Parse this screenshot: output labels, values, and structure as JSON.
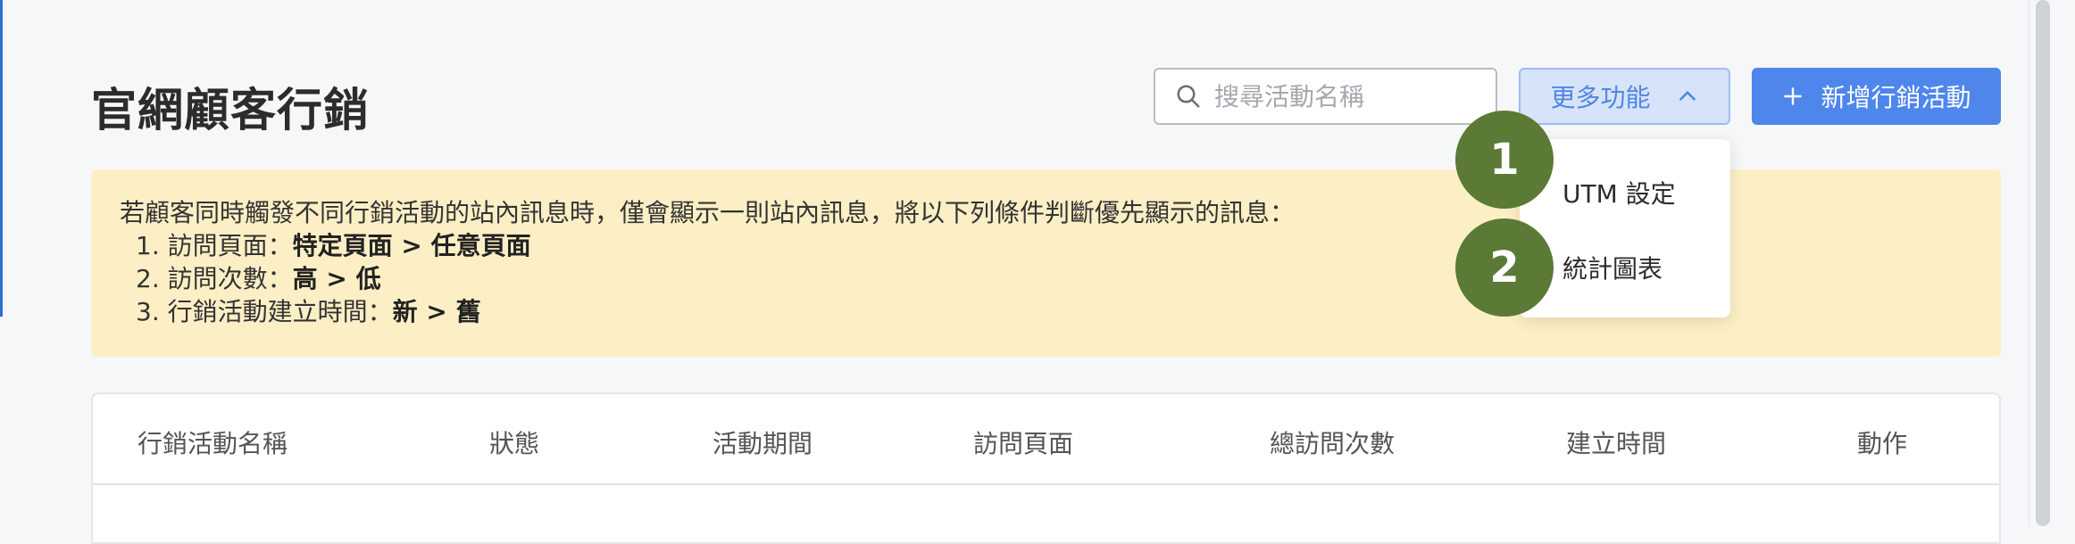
{
  "page_title": "官網顧客行銷",
  "search": {
    "placeholder": "搜尋活動名稱"
  },
  "toolbar": {
    "more_label": "更多功能",
    "add_label": "新增行銷活動"
  },
  "dropdown": {
    "items": [
      {
        "label": "UTM 設定",
        "badge": "1"
      },
      {
        "label": "統計圖表",
        "badge": "2"
      }
    ]
  },
  "notice": {
    "intro": "若顧客同時觸發不同行銷活動的站內訊息時，僅會顯示一則站內訊息，將以下列條件判斷優先顯示的訊息：",
    "items": [
      {
        "prefix": "1. 訪問頁面：",
        "rule": "特定頁面 > 任意頁面"
      },
      {
        "prefix": "2. 訪問次數：",
        "rule": "高 > 低"
      },
      {
        "prefix": "3. 行銷活動建立時間：",
        "rule": "新 > 舊"
      }
    ]
  },
  "table": {
    "columns": [
      "行銷活動名稱",
      "狀態",
      "活動期間",
      "訪問頁面",
      "總訪問次數",
      "建立時間",
      "動作"
    ]
  },
  "colors": {
    "primary": "#4e86ec",
    "notice_bg": "#fdefc5",
    "badge": "#5a7a36"
  },
  "icons": [
    "search-icon",
    "chevron-up-icon",
    "plus-icon"
  ]
}
